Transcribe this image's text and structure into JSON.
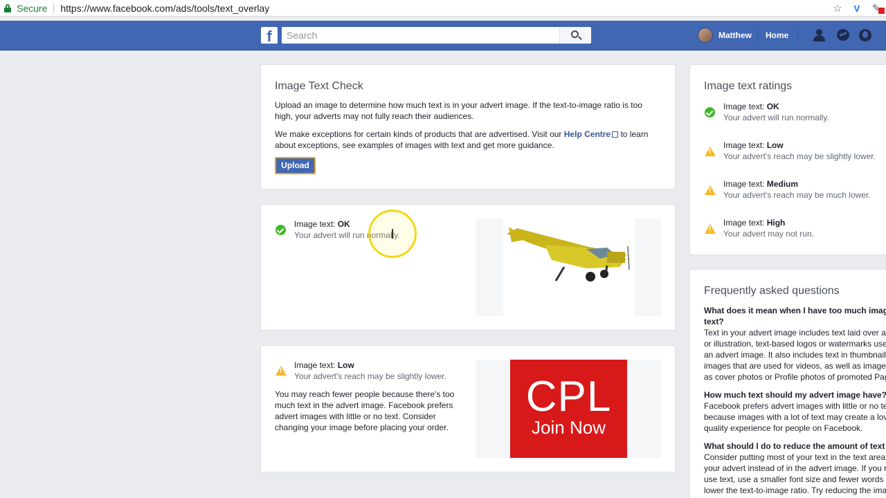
{
  "browser": {
    "secure_label": "Secure",
    "url": "https://www.facebook.com/ads/tools/text_overlay"
  },
  "fb": {
    "logo": "f",
    "search_placeholder": "Search",
    "user_name": "Matthew",
    "home_label": "Home",
    "nav_icons": [
      "friend-requests-icon",
      "messenger-icon",
      "notifications-globe-icon"
    ]
  },
  "check": {
    "title": "Image Text Check",
    "para1_lines": [
      "Upload an image to determine how much text is in your advert image. If the text-to-image ratio is too",
      "high, your adverts may not fully reach their audiences."
    ],
    "para2_line1_pre": "We make exceptions for certain kinds of products that are advertised. Visit our ",
    "help_link": "Help Centre",
    "para2_line1_post": " to learn",
    "para2_line2": "about exceptions, see examples of images with text and get more guidance.",
    "upload_label": "Upload"
  },
  "result1": {
    "label": "Image text: ",
    "rating": "OK",
    "message": "Your advert will run normally."
  },
  "result2": {
    "label": "Image text: ",
    "rating": "Low",
    "message": "Your advert's reach may be slightly lower.",
    "detail_lines": [
      "You may reach fewer people because there's too",
      "much text in the advert image. Facebook prefers",
      "advert images with little or no text. Consider",
      "changing your image before placing your order."
    ],
    "ad_big": "CPL",
    "ad_small": "Join Now"
  },
  "ratings": {
    "title": "Image text ratings",
    "items": [
      {
        "label": "Image text: ",
        "rating": "OK",
        "message": "Your advert will run normally.",
        "icon": "check-icon"
      },
      {
        "label": "Image text: ",
        "rating": "Low",
        "message": "Your advert's reach may be slightly lower.",
        "icon": "warning-icon"
      },
      {
        "label": "Image text: ",
        "rating": "Medium",
        "message": "Your advert's reach may be much lower.",
        "icon": "warning-icon"
      },
      {
        "label": "Image text: ",
        "rating": "High",
        "message": "Your advert may not run.",
        "icon": "warning-icon"
      }
    ]
  },
  "faq": {
    "title": "Frequently asked questions",
    "q1_lines": [
      "What does it mean when I have too much imag",
      "text?"
    ],
    "a1_lines": [
      "Text in your advert image includes text laid over a",
      "or illustration, text-based logos or watermarks use",
      "an advert image. It also includes text in thumbnail",
      "images that are used for videos, as well as image",
      "as cover photos or Profile photos of promoted Pag"
    ],
    "q2": "How much text should my advert image have?",
    "a2_lines": [
      "Facebook prefers advert images with little or no te",
      "because images with a lot of text may create a lov",
      "quality experience for people on Facebook."
    ],
    "q3": "What should I do to reduce the amount of text",
    "a3_lines": [
      "Consider putting most of your text in the text area",
      "your advert instead of in the advert image. If you r",
      "use text, use a smaller font size and fewer words",
      "lower the text-to-image ratio. Try reducing the ima"
    ]
  },
  "colors": {
    "fb_blue": "#4267b2",
    "ok_green": "#42b72a",
    "warn_yellow": "#f7b928",
    "ad_red": "#d7191a"
  }
}
